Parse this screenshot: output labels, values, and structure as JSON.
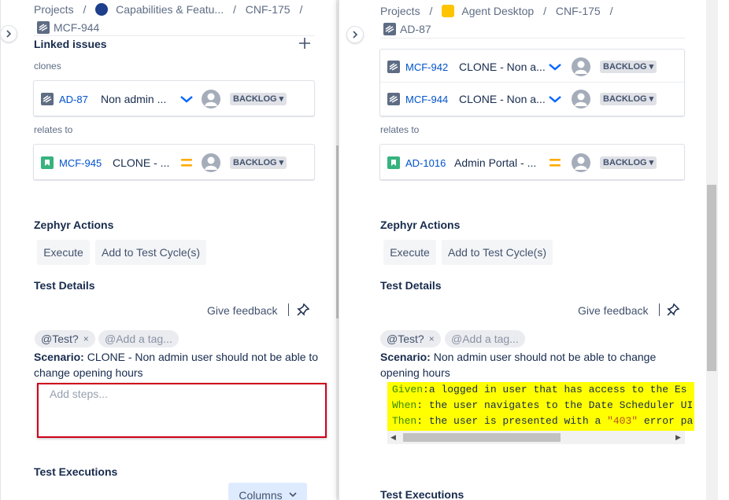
{
  "left": {
    "breadcrumb": {
      "projects": "Projects",
      "sep": "/",
      "project": "Capabilities & Featu...",
      "parent": "CNF-175",
      "issue": "MCF-944"
    },
    "linked_issues_title": "Linked issues",
    "clones_label": "clones",
    "clones": [
      {
        "key": "AD-87",
        "summary": "Non admin ...",
        "badge": "BACKLOG"
      }
    ],
    "relates_label": "relates to",
    "relates": [
      {
        "key": "MCF-945",
        "summary": "CLONE - ...",
        "badge": "BACKLOG"
      }
    ],
    "zephyr_title": "Zephyr Actions",
    "execute": "Execute",
    "add_cycle": "Add to Test Cycle(s)",
    "test_details_title": "Test Details",
    "give_feedback": "Give feedback",
    "tag": "Test?",
    "add_tag": "Add a tag...",
    "scenario_label": "Scenario:",
    "scenario_text": "CLONE - Non admin user should not be able to change opening hours",
    "steps_placeholder": "Add steps...",
    "executions_title": "Test Executions",
    "columns": "Columns"
  },
  "right": {
    "breadcrumb": {
      "projects": "Projects",
      "sep": "/",
      "project": "Agent Desktop",
      "parent": "CNF-175",
      "issue": "AD-87"
    },
    "clones": [
      {
        "key": "MCF-942",
        "summary": "CLONE - Non a...",
        "badge": "BACKLOG"
      },
      {
        "key": "MCF-944",
        "summary": "CLONE - Non a...",
        "badge": "BACKLOG"
      }
    ],
    "relates_label": "relates to",
    "relates": [
      {
        "key": "AD-1016",
        "summary": "Admin Portal - ...",
        "badge": "BACKLOG"
      }
    ],
    "zephyr_title": "Zephyr Actions",
    "execute": "Execute",
    "add_cycle": "Add to Test Cycle(s)",
    "test_details_title": "Test Details",
    "give_feedback": "Give feedback",
    "tag": "Test?",
    "add_tag": "Add a tag...",
    "scenario_label": "Scenario:",
    "scenario_text": "Non admin user should not be able to change opening hours",
    "gherkin": [
      {
        "kw": "Given",
        "rest": ":a logged in user that has access to the Es"
      },
      {
        "kw": "When",
        "rest": ": the user navigates to the Date Scheduler UI"
      },
      {
        "kw": "Then",
        "rest": ": the user is presented with a ",
        "str": "\"403\"",
        "tail": " error pa"
      }
    ],
    "executions_title": "Test Executions"
  },
  "colors": {
    "link": "#0052cc",
    "highlight": "#ffff00",
    "priority_low": "#0065ff",
    "priority_med": "#ffab00",
    "story": "#36b37e",
    "error_border": "#d0021b"
  }
}
